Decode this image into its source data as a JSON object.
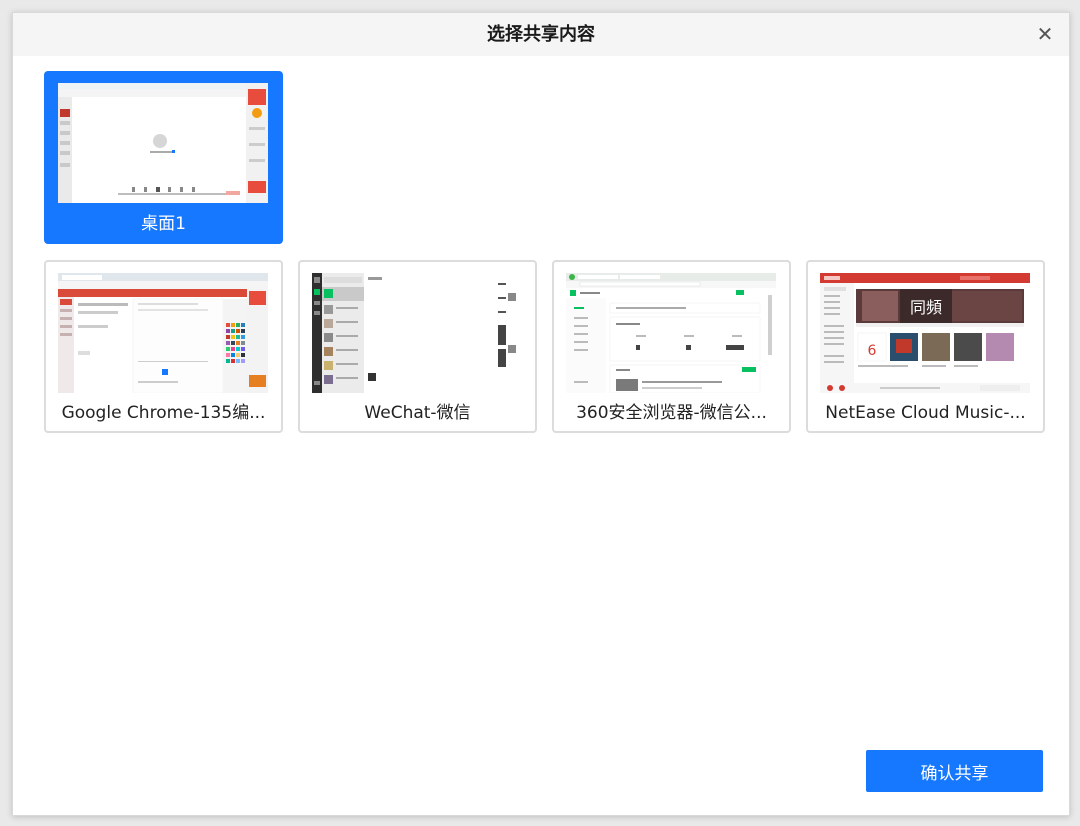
{
  "dialog": {
    "title": "选择共享内容",
    "close_icon": "close-icon",
    "confirm_label": "确认共享"
  },
  "screens": [
    {
      "label": "桌面1",
      "selected": true
    }
  ],
  "windows": [
    {
      "label": "Google Chrome-135编...",
      "app_icon": "chrome-window-preview"
    },
    {
      "label": "WeChat-微信",
      "app_icon": "wechat-window-preview"
    },
    {
      "label": "360安全浏览器-微信公...",
      "app_icon": "browser-window-preview"
    },
    {
      "label": "NetEase Cloud Music-...",
      "app_icon": "music-window-preview"
    }
  ],
  "thumbnail_text": {
    "music_day": "6"
  },
  "colors": {
    "accent": "#1677ff",
    "chrome_red": "#d94a38",
    "wechat_green": "#07c160",
    "netease_red": "#d33a31"
  }
}
